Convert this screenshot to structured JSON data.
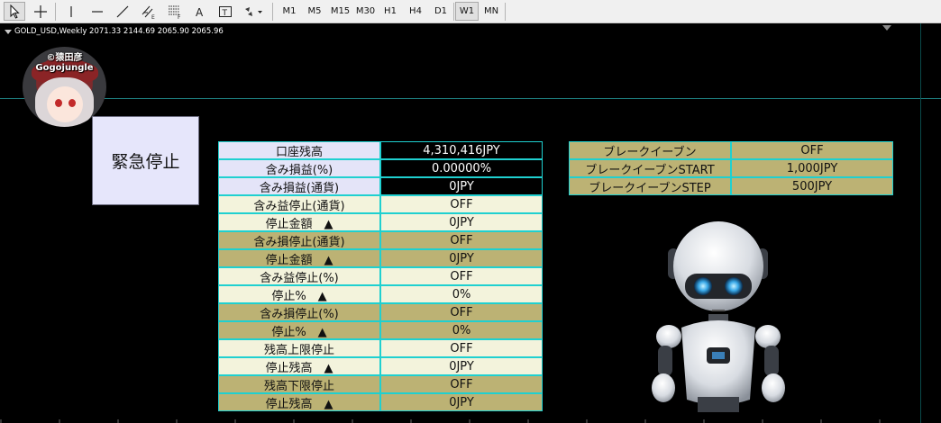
{
  "toolbar": {
    "timeframes": [
      "M1",
      "M5",
      "M15",
      "M30",
      "H1",
      "H4",
      "D1",
      "W1",
      "MN"
    ],
    "selected_timeframe": "W1"
  },
  "chart": {
    "symbol_line": "GOLD_USD,Weekly  2071.33 2144.69 2065.90 2065.96"
  },
  "avatar": {
    "top_text": "©猿田彦",
    "bottom_text": "Gogojungle"
  },
  "emergency_stop": {
    "label": "緊急停止"
  },
  "account_table": [
    {
      "label": "口座残高",
      "value": "4,310,416JPY"
    },
    {
      "label": "含み損益(%)",
      "value": "0.00000%"
    },
    {
      "label": "含み損益(通貨)",
      "value": "0JPY"
    },
    {
      "label": "含み益停止(通貨)",
      "value": "OFF"
    },
    {
      "label": "停止金額　▲",
      "value": "0JPY"
    },
    {
      "label": "含み損停止(通貨)",
      "value": "OFF"
    },
    {
      "label": "停止金額　▲",
      "value": "0JPY"
    },
    {
      "label": "含み益停止(%)",
      "value": "OFF"
    },
    {
      "label": "停止%　▲",
      "value": "0%"
    },
    {
      "label": "含み損停止(%)",
      "value": "OFF"
    },
    {
      "label": "停止%　▲",
      "value": "0%"
    },
    {
      "label": "残高上限停止",
      "value": "OFF"
    },
    {
      "label": "停止残高　▲",
      "value": "0JPY"
    },
    {
      "label": "残高下限停止",
      "value": "OFF"
    },
    {
      "label": "停止残高　▲",
      "value": "0JPY"
    }
  ],
  "breakeven_table": [
    {
      "label": "ブレークイーブン",
      "value": "OFF"
    },
    {
      "label": "ブレークイーブンSTART",
      "value": "1,000JPY"
    },
    {
      "label": "ブレークイーブンSTEP",
      "value": "500JPY"
    }
  ],
  "colors": {
    "cell_border": "#1fd0d0",
    "cream": "#f3f3dc",
    "olive": "#bcb274",
    "lavender": "#e4e4f8"
  }
}
